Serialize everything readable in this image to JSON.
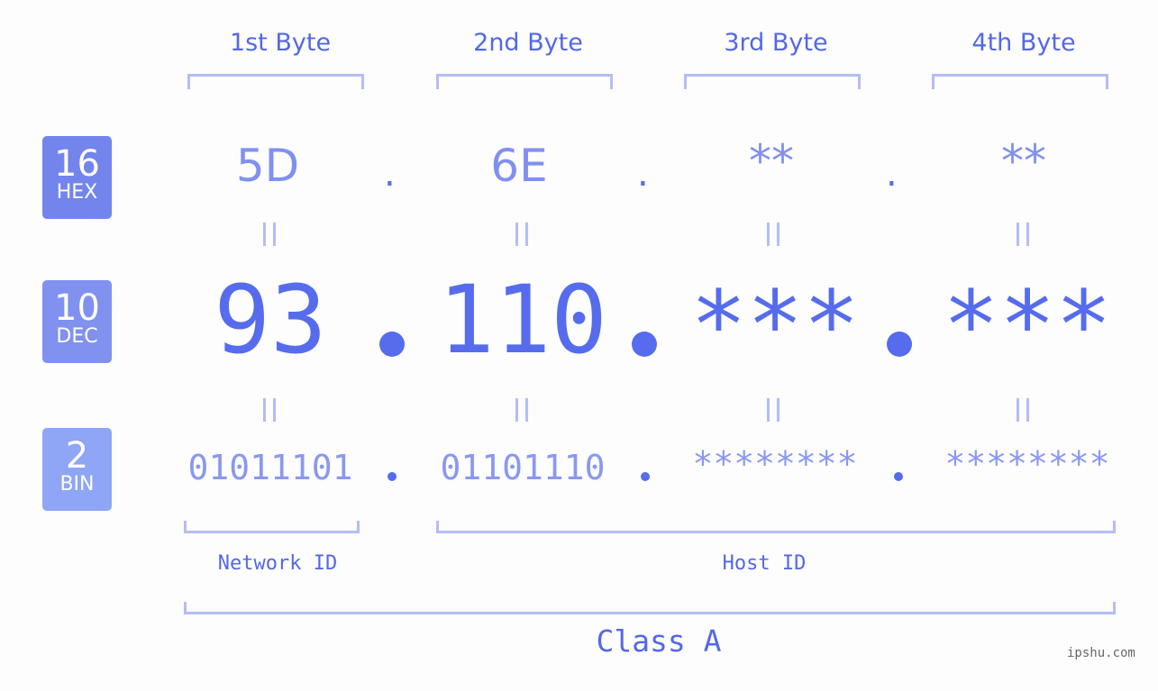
{
  "bytes": [
    {
      "label": "1st Byte",
      "hex": "5D",
      "dec": "93",
      "bin": "01011101"
    },
    {
      "label": "2nd Byte",
      "hex": "6E",
      "dec": "110",
      "bin": "01101110"
    },
    {
      "label": "3rd Byte",
      "hex": "**",
      "dec": "***",
      "bin": "********"
    },
    {
      "label": "4th Byte",
      "hex": "**",
      "dec": "***",
      "bin": "********"
    }
  ],
  "separator": ".",
  "equals": "=",
  "badges": {
    "hex": {
      "num": "16",
      "base": "HEX",
      "color": "#7384ec"
    },
    "dec": {
      "num": "10",
      "base": "DEC",
      "color": "#8091f0"
    },
    "bin": {
      "num": "2",
      "base": "BIN",
      "color": "#8fa5f5"
    }
  },
  "network_label": "Network ID",
  "host_label": "Host ID",
  "class_label": "Class A",
  "watermark": "ipshu.com"
}
